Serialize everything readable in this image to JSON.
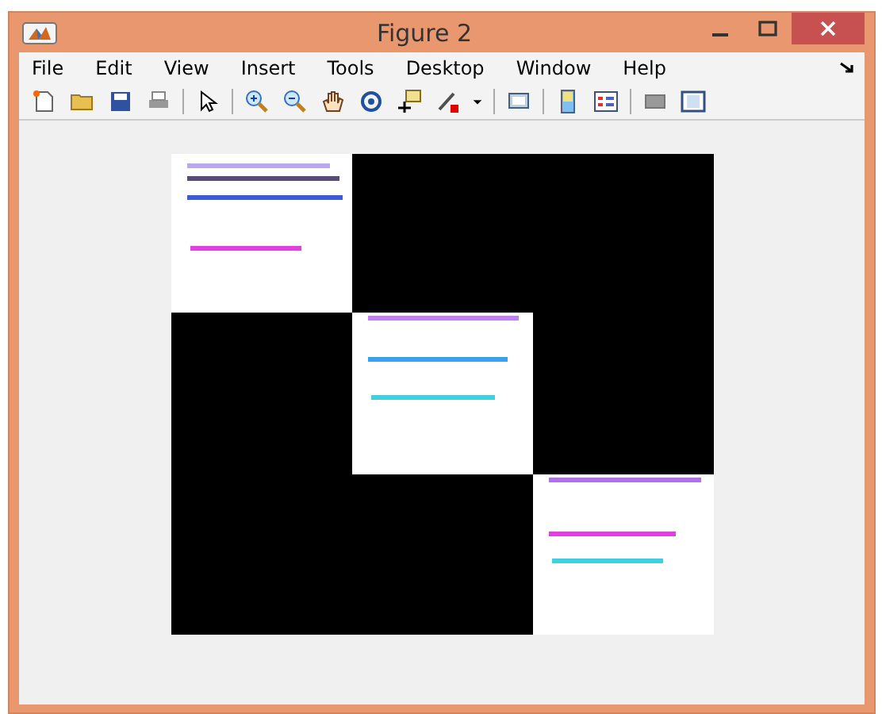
{
  "window": {
    "title": "Figure 2"
  },
  "menu": [
    "File",
    "Edit",
    "View",
    "Insert",
    "Tools",
    "Desktop",
    "Window",
    "Help"
  ]
}
